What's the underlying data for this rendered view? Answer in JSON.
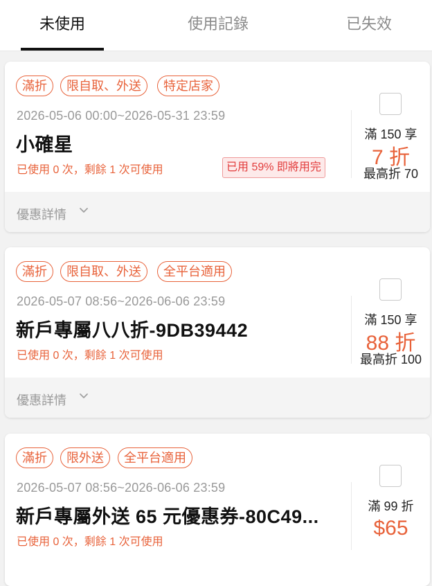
{
  "tabs": [
    {
      "label": "未使用",
      "active": true
    },
    {
      "label": "使用記錄",
      "active": false
    },
    {
      "label": "已失效",
      "active": false
    }
  ],
  "colors": {
    "accent": "#e8623a",
    "warning_text": "#e23b3b",
    "warning_bg": "#fdeaea"
  },
  "coupons": [
    {
      "tags": [
        "滿折",
        "限自取、外送",
        "特定店家"
      ],
      "validity": "2026-05-06 00:00~2026-05-31 23:59",
      "title": "小確星",
      "usage": "已使用 0 次，剩餘 1 次可使用",
      "warning": "已用 59% 即將用完",
      "condition": "滿 150 享",
      "value": "7 折",
      "max": "最高折 70",
      "details_label": "優惠詳情",
      "selected": false
    },
    {
      "tags": [
        "滿折",
        "限自取、外送",
        "全平台適用"
      ],
      "validity": "2026-05-07 08:56~2026-06-06 23:59",
      "title": "新戶專屬八八折-9DB39442",
      "usage": "已使用 0 次，剩餘 1 次可使用",
      "condition": "滿 150 享",
      "value": "88 折",
      "max": "最高折 100",
      "details_label": "優惠詳情",
      "selected": false
    },
    {
      "tags": [
        "滿折",
        "限外送",
        "全平台適用"
      ],
      "validity": "2026-05-07 08:56~2026-06-06 23:59",
      "title": "新戶專屬外送 65 元優惠券-80C49...",
      "usage": "已使用 0 次，剩餘 1 次可使用",
      "condition": "滿 99 折",
      "value": "$65",
      "selected": false
    }
  ]
}
